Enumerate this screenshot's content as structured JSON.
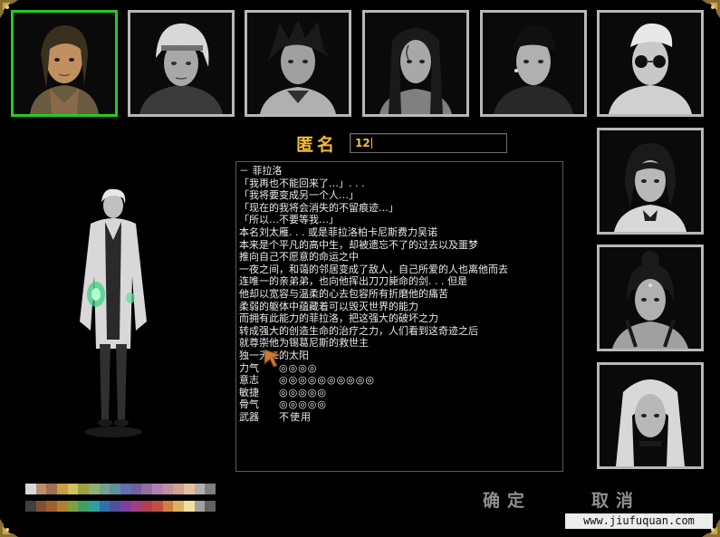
{
  "colors": {
    "selected_border": "#22cc22",
    "frame_border": "#b8b8b8",
    "accent_gold": "#f2b93a"
  },
  "name_field": {
    "label": "匿名",
    "value": "12"
  },
  "portraits_top": [
    {
      "id": "male-brown-hair",
      "selected": true
    },
    {
      "id": "male-white-hair-headband",
      "selected": false
    },
    {
      "id": "male-spiky-black-hair",
      "selected": false
    },
    {
      "id": "male-long-hair-tattoo",
      "selected": false
    },
    {
      "id": "male-short-hair-earring",
      "selected": false
    },
    {
      "id": "male-sunglasses",
      "selected": false
    }
  ],
  "portraits_side": [
    {
      "id": "female-short-hair",
      "selected": false
    },
    {
      "id": "female-bun-hair",
      "selected": false
    },
    {
      "id": "female-long-blonde",
      "selected": false
    }
  ],
  "bio": {
    "lines": [
      "－ 菲拉洛",
      "「我再也不能回来了…」. . .",
      "「我将要变成另一个人…」",
      "「现在的我将会消失的不留痕迹…」",
      "「所以…不要等我…」",
      "本名刘太雁. . . 或是菲拉洛柏卡尼斯费力吴诺",
      "本来是个平凡的高中生，却被遗忘不了的过去以及噩梦",
      "推向自己不愿意的命运之中",
      "一夜之间，和蔼的邻居变成了敌人，自己所爱的人也离他而去",
      "连唯一的亲弟弟，也向他挥出刀刀毙命的剑. . . 但是",
      "他却以宽容与温柔的心去包容所有折磨他的痛苦",
      "柔弱的躯体中蕴藏着可以毁灭世界的能力",
      "而拥有此能力的菲拉洛，把这强大的破坏之力",
      "转成强大的创造生命的治疗之力，人们看到这奇迹之后",
      "就尊崇他为锡葛尼斯的救世主",
      "独一无二的太阳"
    ],
    "stats": [
      {
        "label": "力气",
        "value": "◎◎◎◎"
      },
      {
        "label": "意志",
        "value": "◎◎◎◎◎◎◎◎◎◎"
      },
      {
        "label": "敏捷",
        "value": "◎◎◎◎◎"
      },
      {
        "label": "骨气",
        "value": "◎◎◎◎◎"
      },
      {
        "label": "武器",
        "value": "不使用"
      }
    ]
  },
  "buttons": {
    "confirm": "确定",
    "cancel": "取消"
  },
  "watermark": "www.jiufuquan.com",
  "palette_colors": {
    "row1": [
      "#d8d8d8",
      "#b89070",
      "#a07050",
      "#c8a040",
      "#d0c060",
      "#a0a040",
      "#90b070",
      "#70a090",
      "#6090a0",
      "#6070b0",
      "#7060a0",
      "#9070a0",
      "#b080b0",
      "#c090a0",
      "#d0a090",
      "#e0c0a0",
      "#b0b0b0",
      "#808080"
    ],
    "row2": [
      "#404040",
      "#805030",
      "#a06030",
      "#b08030",
      "#80a040",
      "#40a060",
      "#30a0a0",
      "#3070b0",
      "#5050a0",
      "#8040a0",
      "#a04080",
      "#b04050",
      "#c05040",
      "#d08040",
      "#e0b060",
      "#f0e0a0",
      "#a0a0a0",
      "#606060"
    ]
  }
}
